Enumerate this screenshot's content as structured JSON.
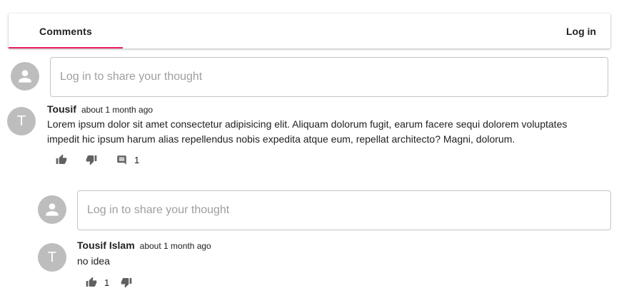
{
  "tabs": [
    {
      "label": "Comments"
    }
  ],
  "header": {
    "login_label": "Log in"
  },
  "colors": {
    "accent": "#e91e63",
    "avatar_bg": "#bdbdbd",
    "icon": "#616161"
  },
  "top_input": {
    "placeholder": "Log in to share your thought",
    "value": ""
  },
  "comments": [
    {
      "avatar_letter": "T",
      "author": "Tousif",
      "time": "about 1 month ago",
      "text": "Lorem ipsum dolor sit amet consectetur adipisicing elit. Aliquam dolorum fugit, earum facere sequi dolorem voluptates impedit hic ipsum harum alias repellendus nobis expedita atque eum, repellat architecto? Magni, dolorum.",
      "reply_count": "1",
      "reply_input": {
        "placeholder": "Log in to share your thought",
        "value": ""
      },
      "replies": [
        {
          "avatar_letter": "T",
          "author": "Tousif Islam",
          "time": "about 1 month ago",
          "text": "no idea",
          "like_count": "1"
        }
      ]
    }
  ],
  "icons": {
    "user": "person-icon",
    "like": "thumb-up-icon",
    "dislike": "thumb-down-icon",
    "reply": "comment-icon"
  }
}
